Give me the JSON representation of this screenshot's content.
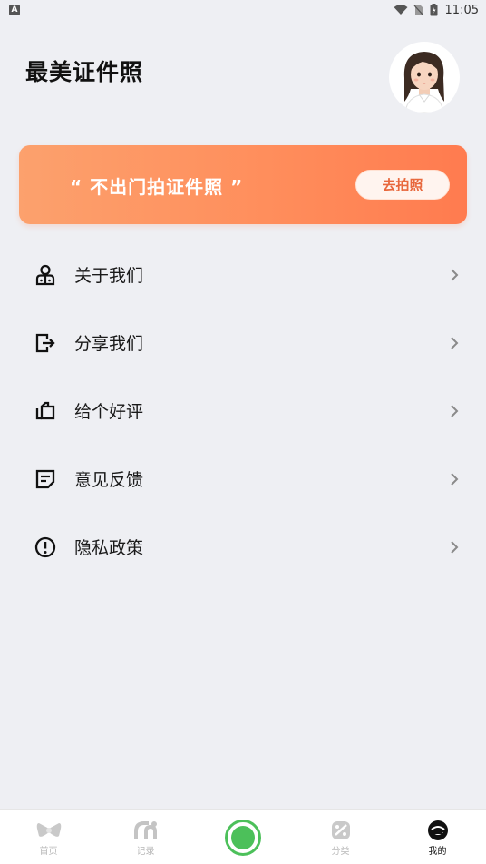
{
  "status_bar": {
    "app_indicator": "A",
    "time": "11:05",
    "icons": [
      "wifi-icon",
      "no-sim-icon",
      "battery-icon"
    ]
  },
  "header": {
    "title": "最美证件照",
    "avatar": "girl-avatar"
  },
  "banner": {
    "text": "“ 不出门拍证件照 ”",
    "button_label": "去拍照",
    "colors": {
      "start": "#fca16d",
      "end": "#ff7b4f",
      "button_text": "#e8683d"
    }
  },
  "menu": {
    "items": [
      {
        "label": "关于我们",
        "icon": "user-badge-icon"
      },
      {
        "label": "分享我们",
        "icon": "share-exit-icon"
      },
      {
        "label": "给个好评",
        "icon": "rate-icon"
      },
      {
        "label": "意见反馈",
        "icon": "feedback-note-icon"
      },
      {
        "label": "隐私政策",
        "icon": "privacy-alert-icon"
      }
    ]
  },
  "bottom_nav": {
    "items": [
      {
        "label": "首页",
        "icon": "home-icon",
        "active": false
      },
      {
        "label": "记录",
        "icon": "record-icon",
        "active": false
      },
      {
        "label": "",
        "icon": "camera-shutter-icon",
        "active": false
      },
      {
        "label": "分类",
        "icon": "category-icon",
        "active": false
      },
      {
        "label": "我的",
        "icon": "profile-icon",
        "active": true
      }
    ],
    "accent": "#4cc05a"
  }
}
